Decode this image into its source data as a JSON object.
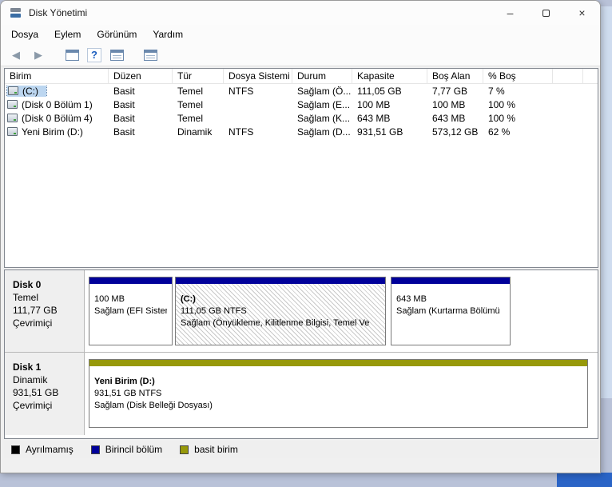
{
  "window": {
    "title": "Disk Yönetimi",
    "controls": {
      "minimize": "–",
      "close": "×"
    }
  },
  "menu": {
    "items": [
      "Dosya",
      "Eylem",
      "Görünüm",
      "Yardım"
    ]
  },
  "toolbar": {
    "icons": [
      "back",
      "forward",
      "show-console-tree",
      "help",
      "show-volume-list",
      "show-graphical-view"
    ],
    "back_glyph": "◀",
    "forward_glyph": "▶",
    "help_glyph": "?"
  },
  "colors": {
    "primary_partition": "#00009a",
    "simple_volume": "#97990a",
    "unallocated": "#000000"
  },
  "volume_table": {
    "columns": [
      "Birim",
      "Düzen",
      "Tür",
      "Dosya Sistemi",
      "Durum",
      "Kapasite",
      "Boş Alan",
      "% Boş"
    ],
    "rows": [
      {
        "birim": "(C:)",
        "duzen": "Basit",
        "tur": "Temel",
        "dosya_sistemi": "NTFS",
        "durum": "Sağlam (Ö...",
        "kapasite": "111,05 GB",
        "bos_alan": "7,77 GB",
        "pct_bos": "7 %"
      },
      {
        "birim": "(Disk 0 Bölüm 1)",
        "duzen": "Basit",
        "tur": "Temel",
        "dosya_sistemi": "",
        "durum": "Sağlam (E...",
        "kapasite": "100 MB",
        "bos_alan": "100 MB",
        "pct_bos": "100 %"
      },
      {
        "birim": "(Disk 0 Bölüm 4)",
        "duzen": "Basit",
        "tur": "Temel",
        "dosya_sistemi": "",
        "durum": "Sağlam (K...",
        "kapasite": "643 MB",
        "bos_alan": "643 MB",
        "pct_bos": "100 %"
      },
      {
        "birim": "Yeni Birim (D:)",
        "duzen": "Basit",
        "tur": "Dinamik",
        "dosya_sistemi": "NTFS",
        "durum": "Sağlam (D...",
        "kapasite": "931,51 GB",
        "bos_alan": "573,12 GB",
        "pct_bos": "62 %"
      }
    ]
  },
  "disks": [
    {
      "name": "Disk 0",
      "type": "Temel",
      "size": "111,77 GB",
      "status": "Çevrimiçi",
      "partitions": [
        {
          "line1": "100 MB",
          "line2": "Sağlam (EFI Sistem",
          "line3": ""
        },
        {
          "line1": "(C:)",
          "line2": "111,05 GB NTFS",
          "line3": "Sağlam (Önyükleme, Kilitlenme Bilgisi, Temel Ve"
        },
        {
          "line1": "643 MB",
          "line2": "Sağlam (Kurtarma Bölümü",
          "line3": ""
        }
      ]
    },
    {
      "name": "Disk 1",
      "type": "Dinamik",
      "size": "931,51 GB",
      "status": "Çevrimiçi",
      "partitions": [
        {
          "line1": "Yeni Birim  (D:)",
          "line2": "931,51 GB NTFS",
          "line3": "Sağlam (Disk Belleği Dosyası)"
        }
      ]
    }
  ],
  "legend": {
    "items": [
      {
        "label": "Ayrılmamış",
        "color": "#000000"
      },
      {
        "label": "Birincil bölüm",
        "color": "#00009a"
      },
      {
        "label": "basit birim",
        "color": "#97990a"
      }
    ]
  }
}
